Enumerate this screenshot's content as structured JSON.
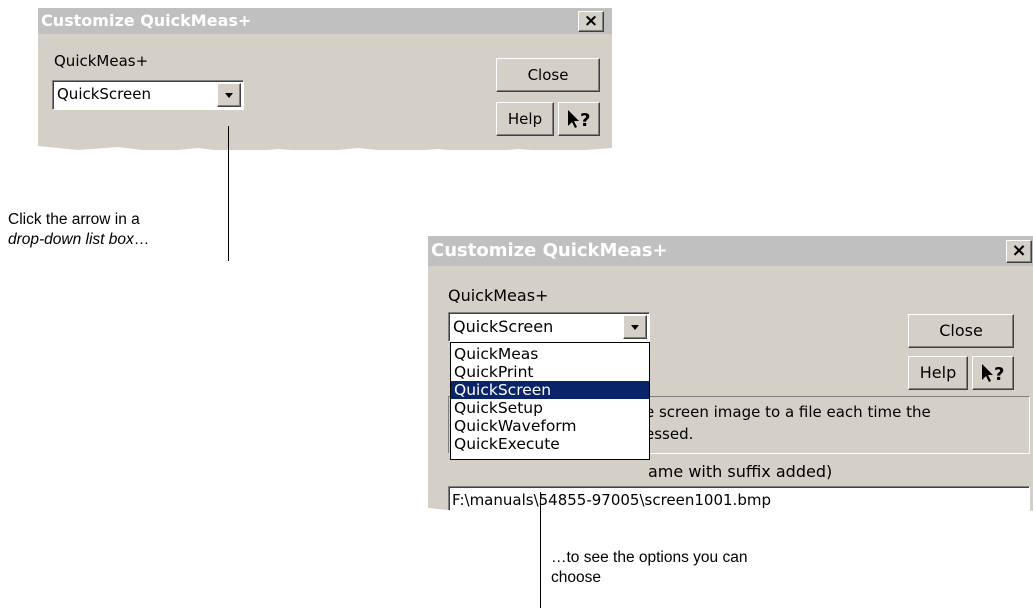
{
  "dialog_top": {
    "title": "Customize QuickMeas+",
    "close_x": "×",
    "label": "QuickMeas+",
    "combo_value": "QuickScreen",
    "close_button": "Close",
    "help_button": "Help",
    "whats_this_glyph": "?"
  },
  "caption_top": {
    "line1": "Click the arrow in a",
    "line2_italic": "drop-down list box",
    "line2_tail": "…"
  },
  "dialog_bottom": {
    "title": "Customize QuickMeas+",
    "close_x": "×",
    "label": "QuickMeas+",
    "combo_value": "QuickScreen",
    "close_button": "Close",
    "help_button": "Help",
    "whats_this_glyph": "?",
    "description_line1": "e screen image to a file each time the",
    "description_line2": "essed.",
    "filename_label": "ame with suffix added)",
    "filename_value": "F:\\manuals\\54855-97005\\screen1001.bmp",
    "options": [
      "QuickMeas",
      "QuickPrint",
      "QuickScreen",
      "QuickSetup",
      "QuickWaveform",
      "QuickExecute"
    ],
    "selected_option": "QuickScreen"
  },
  "caption_bottom": {
    "line1": "…to see the options you can",
    "line2": "choose"
  },
  "colors": {
    "dialog_face": "#d4d0c8",
    "title_bar": "#c0c0c0",
    "selection": "#0a246a"
  }
}
